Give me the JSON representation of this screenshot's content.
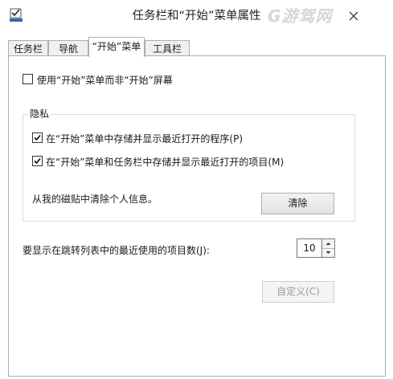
{
  "window": {
    "title": "任务栏和“开始”菜单属性",
    "watermark": "G游驾网"
  },
  "tabs": [
    {
      "label": "任务栏"
    },
    {
      "label": "导航"
    },
    {
      "label": "“开始”菜单",
      "active": true
    },
    {
      "label": "工具栏"
    }
  ],
  "start_menu": {
    "use_start_screen": {
      "label": "使用“开始”菜单而非“开始”屏幕",
      "checked": false
    },
    "privacy": {
      "legend": "隐私",
      "store_programs": {
        "label": "在“开始”菜单中存储并显示最近打开的程序(P)",
        "checked": true
      },
      "store_items": {
        "label": "在“开始”菜单和任务栏中存储并显示最近打开的项目(M)",
        "checked": true
      },
      "clear_text": "从我的磁贴中清除个人信息。",
      "clear_button": "清除"
    },
    "jump_list": {
      "label": "要显示在跳转列表中的最近使用的项目数(J):",
      "value": "10"
    },
    "customize_button": "自定义(C)"
  },
  "colors": {
    "accent_border": "#adadad",
    "disabled_text": "#9a9a9a"
  }
}
